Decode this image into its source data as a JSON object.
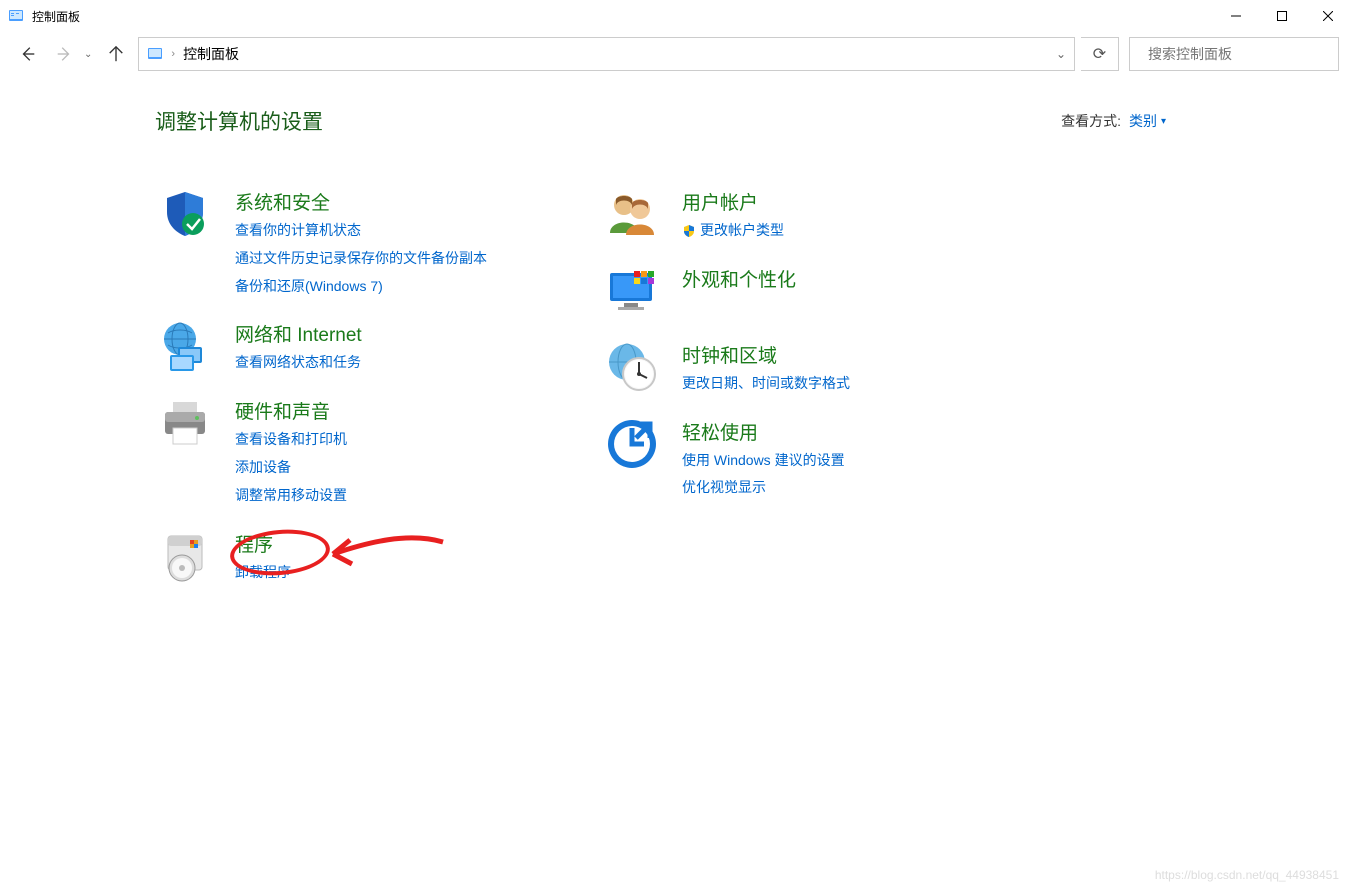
{
  "window": {
    "title": "控制面板"
  },
  "address": {
    "location": "控制面板"
  },
  "search": {
    "placeholder": "搜索控制面板"
  },
  "header": {
    "title": "调整计算机的设置",
    "viewLabel": "查看方式:",
    "viewValue": "类别"
  },
  "left": [
    {
      "title": "系统和安全",
      "links": [
        "查看你的计算机状态",
        "通过文件历史记录保存你的文件备份副本",
        "备份和还原(Windows 7)"
      ]
    },
    {
      "title": "网络和 Internet",
      "links": [
        "查看网络状态和任务"
      ]
    },
    {
      "title": "硬件和声音",
      "links": [
        "查看设备和打印机",
        "添加设备",
        "调整常用移动设置"
      ]
    },
    {
      "title": "程序",
      "links": [
        "卸载程序"
      ]
    }
  ],
  "right": [
    {
      "title": "用户帐户",
      "links": [
        "更改帐户类型"
      ],
      "shield": true
    },
    {
      "title": "外观和个性化",
      "links": []
    },
    {
      "title": "时钟和区域",
      "links": [
        "更改日期、时间或数字格式"
      ]
    },
    {
      "title": "轻松使用",
      "links": [
        "使用 Windows 建议的设置",
        "优化视觉显示"
      ]
    }
  ],
  "watermark": "https://blog.csdn.net/qq_44938451"
}
